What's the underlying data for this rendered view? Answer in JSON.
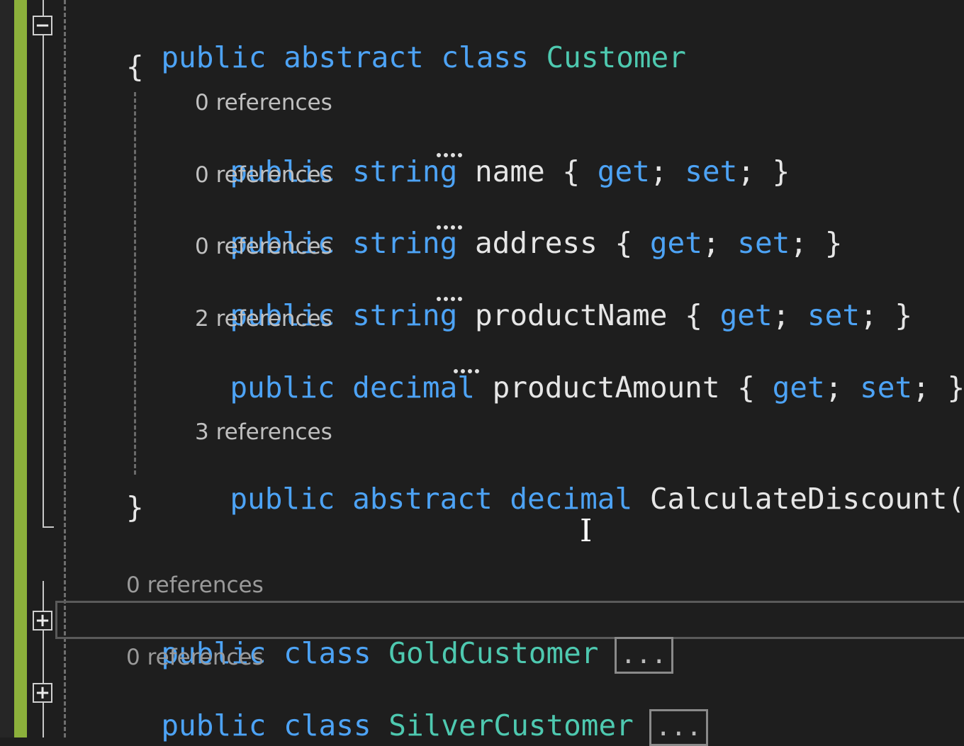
{
  "outline": {
    "collapse_symbol": "−",
    "expand_symbol": "+"
  },
  "code": {
    "class_decl": {
      "kw1": "public",
      "kw2": "abstract",
      "kw3": "class",
      "name": "Customer"
    },
    "open_brace": "{",
    "close_brace": "}",
    "members": [
      {
        "refs": "0 references",
        "kw": "public",
        "type": "string",
        "name": "name",
        "accessors": "{ ",
        "get": "get",
        "sep": "; ",
        "set": "set",
        "end": "; }"
      },
      {
        "refs": "0 references",
        "kw": "public",
        "type": "string",
        "name": "address",
        "accessors": "{ ",
        "get": "get",
        "sep": "; ",
        "set": "set",
        "end": "; }"
      },
      {
        "refs": "0 references",
        "kw": "public",
        "type": "string",
        "name": "productName",
        "accessors": "{ ",
        "get": "get",
        "sep": "; ",
        "set": "set",
        "end": "; }"
      },
      {
        "refs": "2 references",
        "kw": "public",
        "type": "decimal",
        "name": "productAmount",
        "accessors": "{ ",
        "get": "get",
        "sep": "; ",
        "set": "set",
        "end": "; }"
      }
    ],
    "method": {
      "refs": "3 references",
      "kw1": "public",
      "kw2": "abstract",
      "kw3": "decimal",
      "name": "CalculateDiscount();"
    },
    "collapsed_classes": [
      {
        "refs": "0 references",
        "kw1": "public",
        "kw2": "class",
        "name": "GoldCustomer",
        "ellipsis": "..."
      },
      {
        "refs": "0 references",
        "kw1": "public",
        "kw2": "class",
        "name": "SilverCustomer",
        "ellipsis": "..."
      }
    ]
  },
  "colors": {
    "background": "#1e1e1e",
    "keyword": "#4da3f5",
    "type": "#4ec9b0",
    "text": "#e6e6e6",
    "change_bar": "#8cb03b"
  },
  "cursor": "I"
}
